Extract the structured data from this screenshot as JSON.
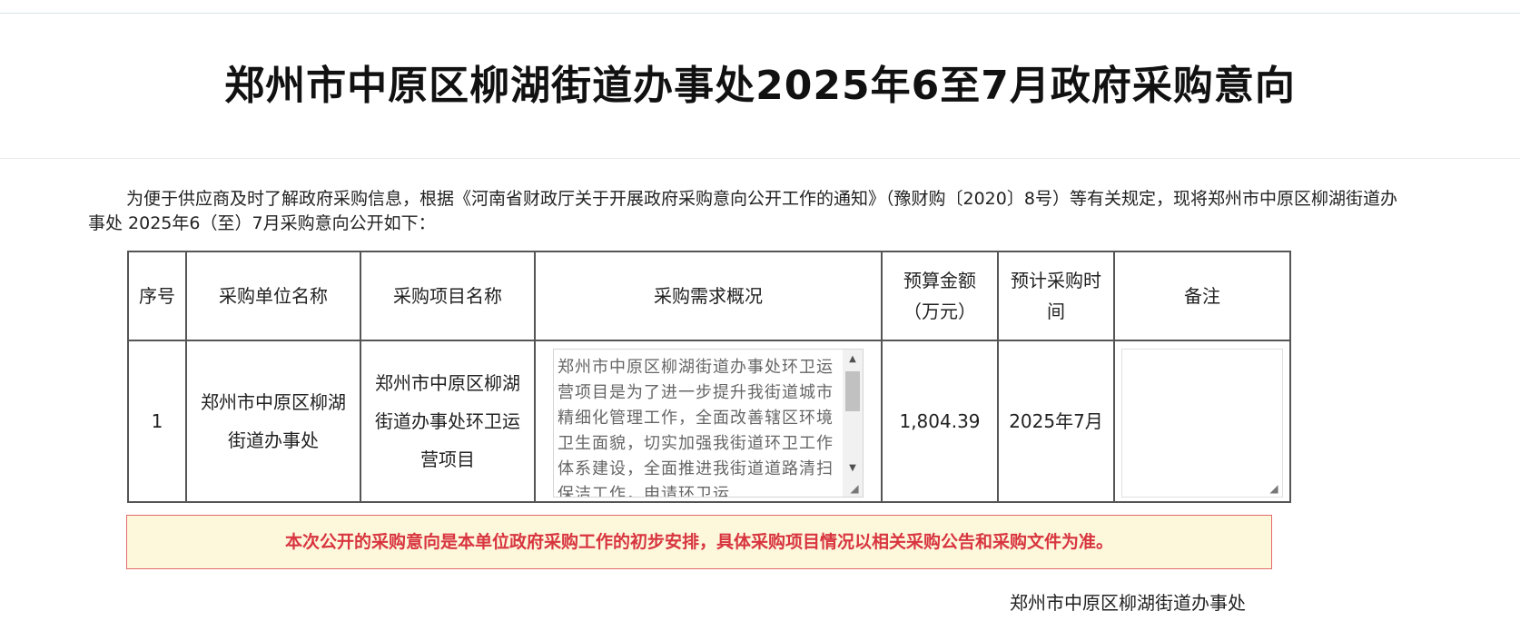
{
  "page": {
    "title": "郑州市中原区柳湖街道办事处2025年6至7月政府采购意向",
    "intro": "为便于供应商及时了解政府采购信息，根据《河南省财政厅关于开展政府采购意向公开工作的通知》（豫财购〔2020〕8号）等有关规定，现将郑州市中原区柳湖街道办事处 2025年6（至）7月采购意向公开如下：",
    "notice": "本次公开的采购意向是本单位政府采购工作的初步安排，具体采购项目情况以相关采购公告和采购文件为准。",
    "signature": "郑州市中原区柳湖街道办事处"
  },
  "table": {
    "headers": {
      "no": "序号",
      "unit": "采购单位名称",
      "project": "采购项目名称",
      "desc": "采购需求概况",
      "budget": "预算金额（万元）",
      "time": "预计采购时间",
      "note": "备注"
    },
    "rows": [
      {
        "no": "1",
        "unit": "郑州市中原区柳湖街道办事处",
        "project": "郑州市中原区柳湖街道办事处环卫运营项目",
        "desc": "郑州市中原区柳湖街道办事处环卫运营项目是为了进一步提升我街道城市精细化管理工作，全面改善辖区环境卫生面貌，切实加强我街道环卫工作体系建设，全面推进我街道道路清扫保洁工作，申请环卫运",
        "budget": "1,804.39",
        "time": "2025年7月",
        "note": ""
      }
    ]
  },
  "icons": {
    "scroll_up": "scroll-up-arrow-icon",
    "scroll_down": "scroll-down-arrow-icon",
    "resize": "resize-grip-icon"
  },
  "colors": {
    "notice_text": "#d8353f",
    "notice_bg": "#fdf7dc",
    "notice_border": "#e36a6a",
    "table_border": "#555555"
  }
}
